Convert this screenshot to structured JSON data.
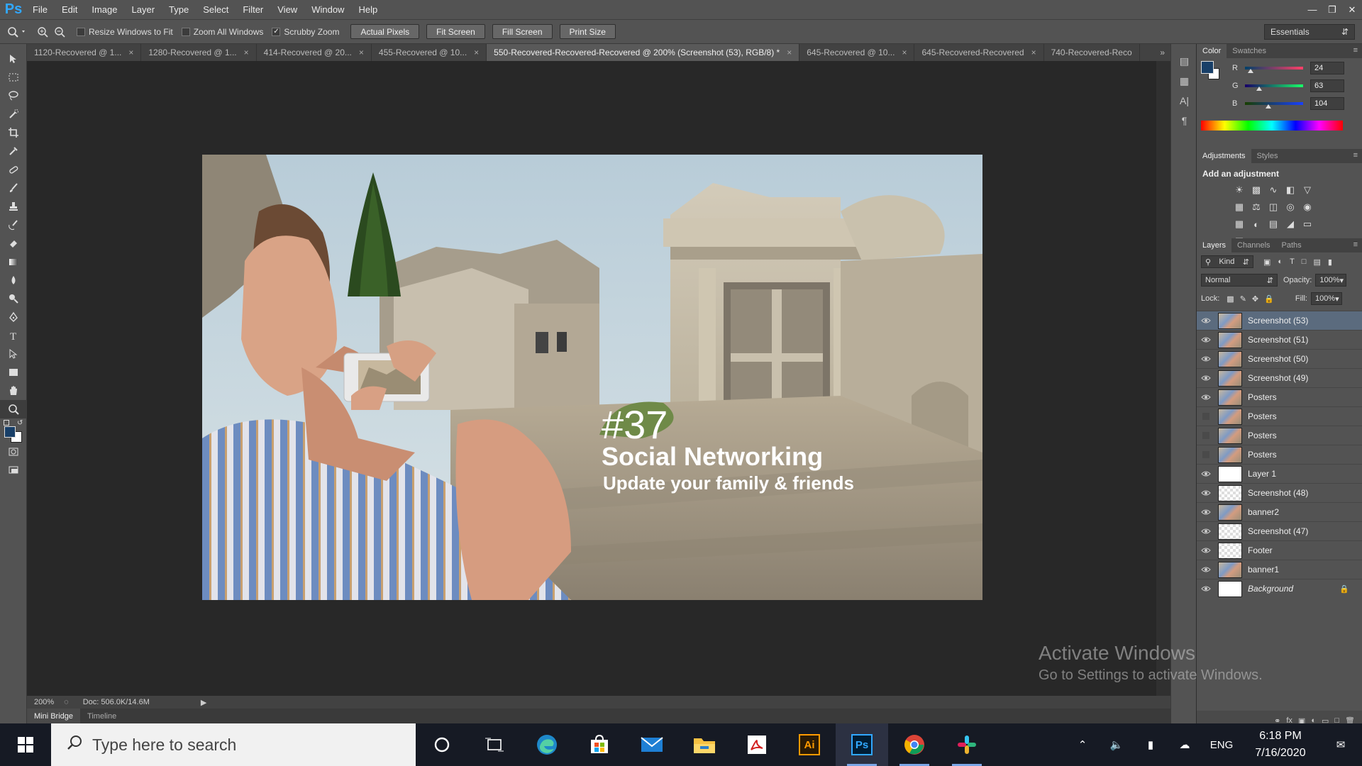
{
  "menubar": {
    "logo": "Ps",
    "items": [
      "File",
      "Edit",
      "Image",
      "Layer",
      "Type",
      "Select",
      "Filter",
      "View",
      "Window",
      "Help"
    ]
  },
  "options": {
    "checks": [
      {
        "label": "Resize Windows to Fit",
        "checked": false
      },
      {
        "label": "Zoom All Windows",
        "checked": false
      },
      {
        "label": "Scrubby Zoom",
        "checked": true
      }
    ],
    "buttons": [
      "Actual Pixels",
      "Fit Screen",
      "Fill Screen",
      "Print Size"
    ],
    "workspace": "Essentials"
  },
  "tabs": [
    {
      "label": "1120-Recovered @ 1...",
      "active": false
    },
    {
      "label": "1280-Recovered @ 1...",
      "active": false
    },
    {
      "label": "414-Recovered @ 20...",
      "active": false
    },
    {
      "label": "455-Recovered @ 10...",
      "active": false
    },
    {
      "label": "550-Recovered-Recovered-Recovered @ 200% (Screenshot (53), RGB/8) *",
      "active": true
    },
    {
      "label": "645-Recovered @ 10...",
      "active": false
    },
    {
      "label": "645-Recovered-Recovered",
      "active": false
    },
    {
      "label": "740-Recovered-Reco",
      "active": false
    }
  ],
  "document": {
    "number": "#37",
    "title": "Social Networking",
    "subtitle": "Update your family & friends"
  },
  "status": {
    "zoom": "200%",
    "doc": "Doc: 506.0K/14.6M"
  },
  "bottom_tabs": [
    "Mini Bridge",
    "Timeline"
  ],
  "color_panel": {
    "tabs": [
      "Color",
      "Swatches"
    ],
    "r": "24",
    "g": "63",
    "b": "104",
    "fg_color": "#183f68",
    "r_label": "R",
    "g_label": "G",
    "b_label": "B"
  },
  "adjustments": {
    "tabs": [
      "Adjustments",
      "Styles"
    ],
    "title": "Add an adjustment",
    "icons": [
      "brightness-contrast",
      "levels",
      "curves",
      "exposure",
      "vibrance",
      "hue-saturation",
      "color-balance",
      "black-white",
      "photo-filter",
      "channel-mixer",
      "color-lookup",
      "invert",
      "posterize",
      "threshold",
      "gradient-map",
      "selective-color"
    ]
  },
  "layers": {
    "tabs": [
      "Layers",
      "Channels",
      "Paths"
    ],
    "kind": "Kind",
    "blend": "Normal",
    "opacity_label": "Opacity:",
    "opacity": "100%",
    "lock_label": "Lock:",
    "fill_label": "Fill:",
    "fill": "100%",
    "items": [
      {
        "name": "Screenshot (53)",
        "visible": true,
        "selected": true,
        "thumb": "photo"
      },
      {
        "name": "Screenshot (51)",
        "visible": true,
        "selected": false,
        "thumb": "photo"
      },
      {
        "name": "Screenshot (50)",
        "visible": true,
        "selected": false,
        "thumb": "photo"
      },
      {
        "name": "Screenshot (49)",
        "visible": true,
        "selected": false,
        "thumb": "photo"
      },
      {
        "name": "Posters",
        "visible": true,
        "selected": false,
        "thumb": "photo"
      },
      {
        "name": "Posters",
        "visible": false,
        "selected": false,
        "thumb": "photo"
      },
      {
        "name": "Posters",
        "visible": false,
        "selected": false,
        "thumb": "photo"
      },
      {
        "name": "Posters",
        "visible": false,
        "selected": false,
        "thumb": "photo"
      },
      {
        "name": "Layer 1",
        "visible": true,
        "selected": false,
        "thumb": "white"
      },
      {
        "name": "Screenshot (48)",
        "visible": true,
        "selected": false,
        "thumb": "transparent"
      },
      {
        "name": "banner2",
        "visible": true,
        "selected": false,
        "thumb": "photo"
      },
      {
        "name": "Screenshot (47)",
        "visible": true,
        "selected": false,
        "thumb": "transparent"
      },
      {
        "name": "Footer",
        "visible": true,
        "selected": false,
        "thumb": "transparent"
      },
      {
        "name": "banner1",
        "visible": true,
        "selected": false,
        "thumb": "photo"
      },
      {
        "name": "Background",
        "visible": true,
        "selected": false,
        "thumb": "white",
        "italic": true,
        "locked": true
      }
    ]
  },
  "watermark": {
    "line1": "Activate Windows",
    "line2": "Go to Settings to activate Windows."
  },
  "taskbar": {
    "search_placeholder": "Type here to search",
    "apps": [
      "cortana",
      "task-view",
      "edge",
      "store",
      "mail",
      "file-explorer",
      "acrobat",
      "illustrator",
      "photoshop",
      "chrome",
      "slack"
    ],
    "ai_label": "Ai",
    "ps_label": "Ps",
    "lang": "ENG",
    "time": "6:18 PM",
    "date": "7/16/2020"
  }
}
